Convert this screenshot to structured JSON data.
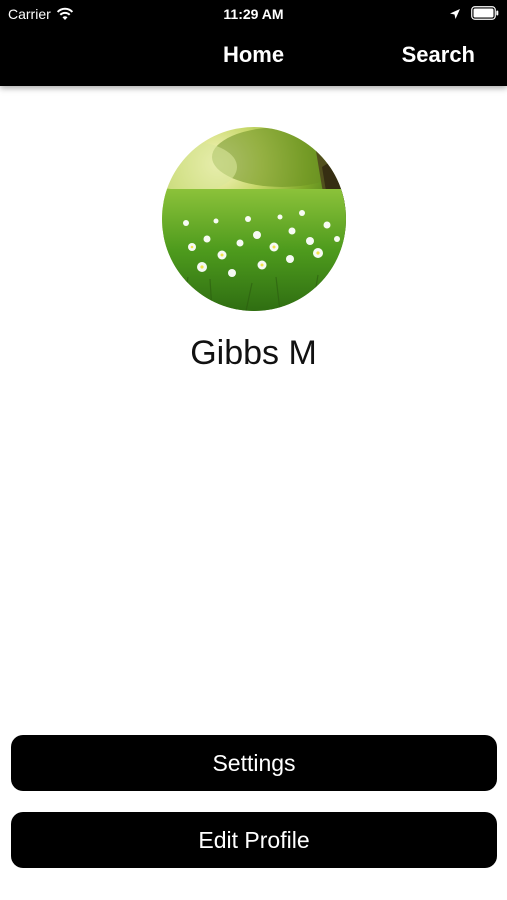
{
  "status_bar": {
    "carrier": "Carrier",
    "time": "11:29 AM",
    "wifi_icon": "wifi-icon",
    "location_icon": "location-arrow-icon",
    "battery_icon": "battery-icon"
  },
  "nav": {
    "title": "Home",
    "search_label": "Search"
  },
  "profile": {
    "name": "Gibbs M",
    "avatar_image": "meadow-with-daisies"
  },
  "buttons": {
    "settings_label": "Settings",
    "edit_profile_label": "Edit Profile"
  },
  "colors": {
    "header_bg": "#000000",
    "button_bg": "#000000",
    "button_text": "#ffffff",
    "page_bg": "#ffffff"
  }
}
